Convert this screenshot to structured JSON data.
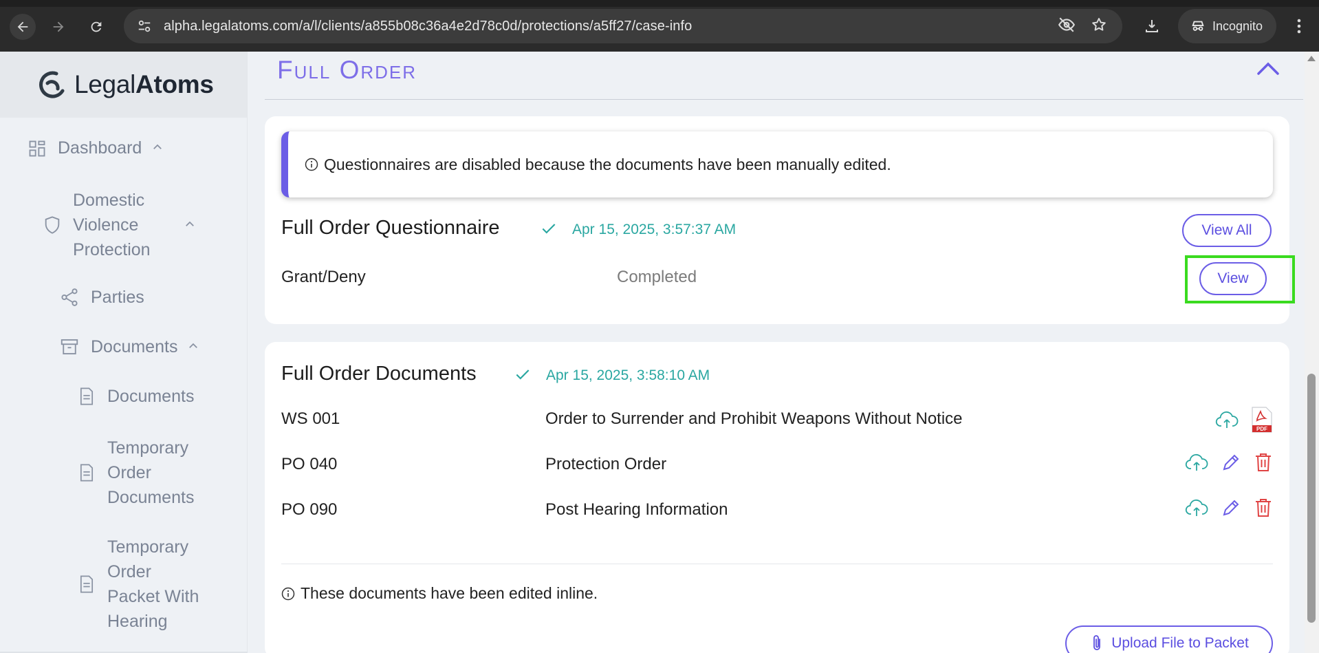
{
  "browser": {
    "url": "alpha.legalatoms.com/a/l/clients/a855b08c36a4e2d78c0d/protections/a5ff27/case-info",
    "incognito_label": "Incognito"
  },
  "sidebar": {
    "logo_regular": "Legal",
    "logo_bold": "Atoms",
    "items": [
      {
        "label": "Dashboard"
      },
      {
        "label_lines": [
          "Domestic",
          "Violence",
          "Protection"
        ]
      },
      {
        "label": "Parties"
      },
      {
        "label": "Documents"
      },
      {
        "label": "Documents"
      },
      {
        "label_lines": [
          "Temporary",
          "Order",
          "Documents"
        ]
      },
      {
        "label_lines": [
          "Temporary",
          "Order",
          "Packet With",
          "Hearing"
        ]
      }
    ]
  },
  "section": {
    "title": "Full Order"
  },
  "questionnaire_card": {
    "alert_text": "Questionnaires are disabled because the documents have been manually edited.",
    "title": "Full Order Questionnaire",
    "timestamp": "Apr 15, 2025, 3:57:37 AM",
    "view_all_label": "View All",
    "rows": [
      {
        "label": "Grant/Deny",
        "status": "Completed",
        "action_label": "View"
      }
    ]
  },
  "documents_card": {
    "title": "Full Order Documents",
    "timestamp": "Apr 15, 2025, 3:58:10 AM",
    "rows": [
      {
        "code": "WS 001",
        "name": "Order to Surrender and Prohibit Weapons Without Notice"
      },
      {
        "code": "PO 040",
        "name": "Protection Order"
      },
      {
        "code": "PO 090",
        "name": "Post Hearing Information"
      }
    ],
    "pdf_badge": "PDF",
    "edited_note": "These documents have been edited inline.",
    "upload_label": "Upload File to Packet"
  },
  "colors": {
    "accent": "#6b5de6",
    "teal": "#2aa7a1",
    "danger": "#e04444",
    "highlight": "#3adb1f"
  }
}
